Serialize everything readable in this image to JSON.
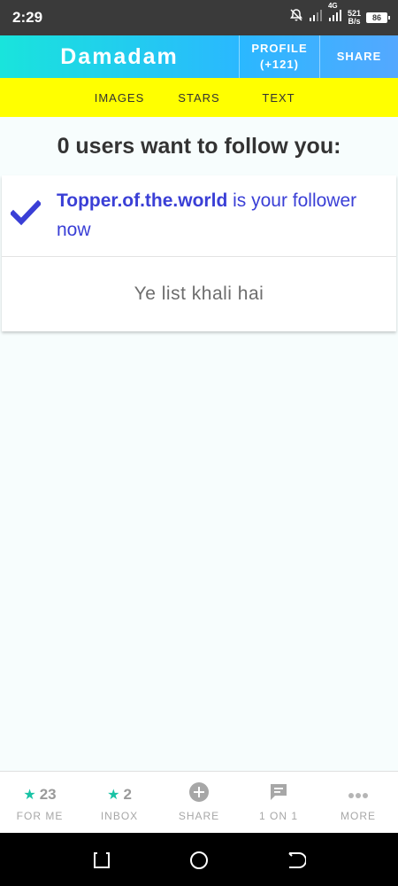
{
  "status_bar": {
    "time": "2:29",
    "network_label": "4G",
    "speed_value": "521",
    "speed_unit": "B/s",
    "battery": "86"
  },
  "header": {
    "brand": "Damadam",
    "profile_label": "PROFILE",
    "profile_count": "(+121)",
    "share_label": "SHARE"
  },
  "tabs": [
    {
      "label": "IMAGES"
    },
    {
      "label": "STARS"
    },
    {
      "label": "TEXT"
    }
  ],
  "main": {
    "heading": "0 users want to follow you:",
    "follower_name": "Topper.of.the.world",
    "follower_suffix": " is your follower now",
    "empty_text": "Ye list khali hai"
  },
  "bottom_nav": [
    {
      "count": "23",
      "label": "FOR ME",
      "icon": "star-icon"
    },
    {
      "count": "2",
      "label": "INBOX",
      "icon": "star-icon"
    },
    {
      "count": "",
      "label": "SHARE",
      "icon": "plus-circle-icon"
    },
    {
      "count": "",
      "label": "1 ON 1",
      "icon": "chat-icon"
    },
    {
      "count": "",
      "label": "MORE",
      "icon": "more-dots-icon"
    }
  ],
  "colors": {
    "accent_yellow": "#ffff00",
    "brand_gradient_start": "#19e4dc",
    "brand_gradient_end": "#54a8ff",
    "link_blue": "#3a3fd6",
    "star_teal": "#18c3a5"
  }
}
